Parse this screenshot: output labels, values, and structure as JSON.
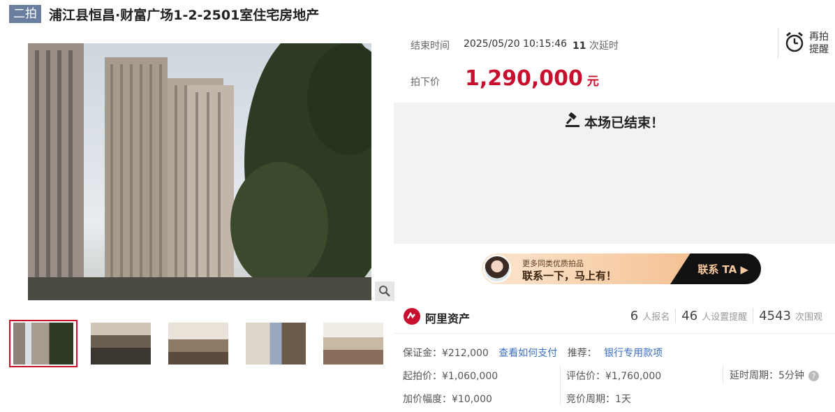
{
  "header": {
    "badge": "二拍",
    "title": "浦江县恒昌·财富广场1-2-2501室住宅房地产"
  },
  "auction": {
    "end_label": "结束时间",
    "end_time": "2025/05/20 10:15:46",
    "delay_count": "11",
    "delay_suffix": "次延时",
    "remind_line1": "再拍",
    "remind_line2": "提醒",
    "price_label": "拍下价",
    "price": "1,290,000",
    "price_unit": "元",
    "ended_text": "本场已结束！"
  },
  "banner": {
    "line1": "更多同类优质拍品",
    "line2": "联系一下，马上有！",
    "cta": "联系 TA"
  },
  "info": {
    "brand": "阿里资产",
    "stats": [
      {
        "num": "6",
        "label": "人报名"
      },
      {
        "num": "46",
        "label": "人设置提醒"
      },
      {
        "num": "4543",
        "label": "次围观"
      }
    ],
    "deposit": "保证金：¥212,000",
    "deposit_link": "查看如何支付",
    "recommend_label": "推荐：",
    "recommend_link": "银行专用款项",
    "start_price": "起拍价：¥1,060,000",
    "appraisal": "评估价：¥1,760,000",
    "delay_period": "延时周期：5分钟",
    "increment": "加价幅度：¥10,000",
    "cycle": "竞价周期：1天"
  },
  "colors": {
    "accent": "#c8102e",
    "badge": "#6a7ea0",
    "link": "#3a6fc4"
  }
}
